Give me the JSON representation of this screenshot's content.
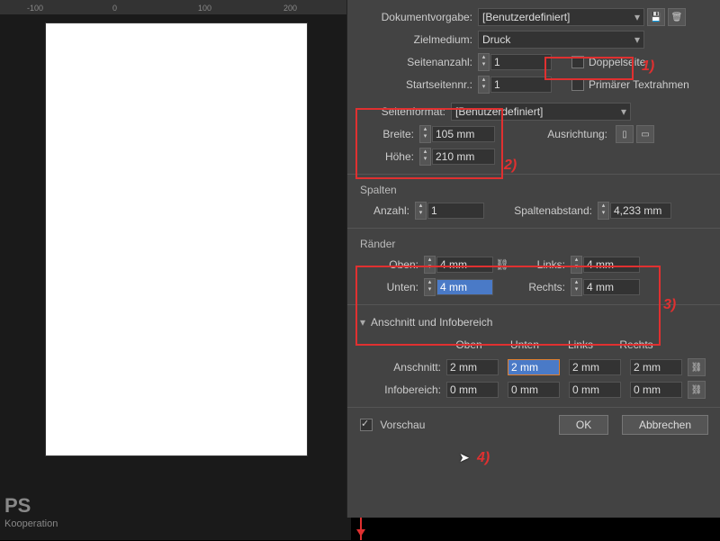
{
  "ruler": [
    "-100",
    "0",
    "100",
    "200"
  ],
  "preset": {
    "label": "Dokumentvorgabe:",
    "value": "[Benutzerdefiniert]"
  },
  "intent": {
    "label": "Zielmedium:",
    "value": "Druck"
  },
  "pages": {
    "label": "Seitenanzahl:",
    "value": "1",
    "facing": "Doppelseite"
  },
  "start": {
    "label": "Startseitennr.:",
    "value": "1",
    "frame": "Primärer Textrahmen"
  },
  "pageSize": {
    "label": "Seitenformat:",
    "value": "[Benutzerdefiniert]"
  },
  "width": {
    "label": "Breite:",
    "value": "105 mm"
  },
  "height": {
    "label": "Höhe:",
    "value": "210 mm"
  },
  "orient": {
    "label": "Ausrichtung:"
  },
  "columns": {
    "title": "Spalten",
    "count_label": "Anzahl:",
    "count": "1",
    "gutter_label": "Spaltenabstand:",
    "gutter": "4,233 mm"
  },
  "margins": {
    "title": "Ränder",
    "top_label": "Oben:",
    "top": "4 mm",
    "bottom_label": "Unten:",
    "bottom": "4 mm",
    "left_label": "Links:",
    "left": "4 mm",
    "right_label": "Rechts:",
    "right": "4 mm"
  },
  "bleedSlug": {
    "title": "Anschnitt und Infobereich",
    "h_top": "Oben",
    "h_bottom": "Unten",
    "h_left": "Links",
    "h_right": "Rechts",
    "bleed_label": "Anschnitt:",
    "bleed": {
      "top": "2 mm",
      "bottom": "2 mm",
      "left": "2 mm",
      "right": "2 mm"
    },
    "slug_label": "Infobereich:",
    "slug": {
      "top": "0 mm",
      "bottom": "0 mm",
      "left": "0 mm",
      "right": "0 mm"
    }
  },
  "preview": "Vorschau",
  "ok": "OK",
  "cancel": "Abbrechen",
  "annotations": {
    "a1": "1)",
    "a2": "2)",
    "a3": "3)",
    "a4": "4)"
  },
  "logo": {
    "text": "PS",
    "sub": "Kooperation"
  }
}
